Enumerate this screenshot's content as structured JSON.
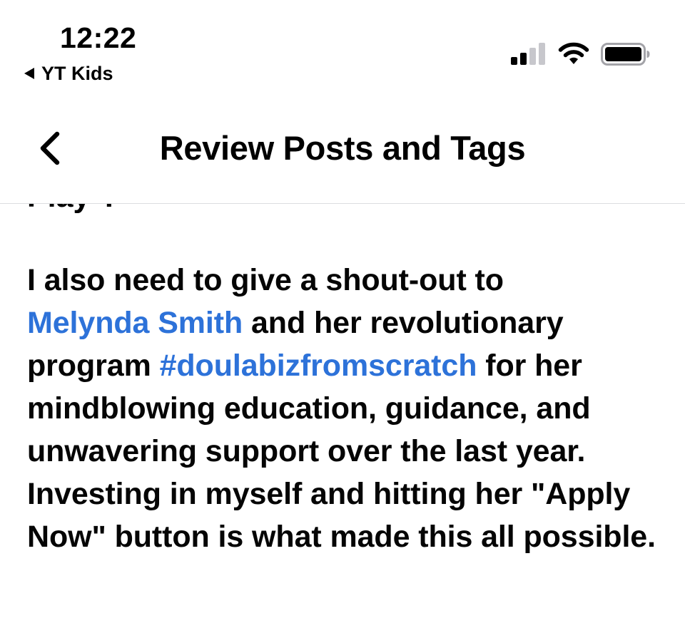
{
  "status_bar": {
    "time": "12:22",
    "back_app_label": "YT Kids",
    "signal_icon": "cellular-signal-icon",
    "wifi_icon": "wifi-icon",
    "battery_icon": "battery-icon"
  },
  "nav": {
    "back_icon": "chevron-left-icon",
    "title": "Review Posts and Tags"
  },
  "post": {
    "clipped_previous_line": "Play\".",
    "lines": [
      [
        "I also need to give a shout-out to"
      ],
      [
        "Melynda Smith",
        " and her revolutionary"
      ],
      [
        "program ",
        "#doulabizfromscratch",
        " for her"
      ],
      [
        "mindblowing education, guidance, and"
      ],
      [
        "unwavering support over the last year."
      ],
      [
        "Investing in myself and hitting her"
      ],
      [
        "\"Apply Now\" button is what made this"
      ],
      [
        "all possible."
      ]
    ],
    "mention": "Melynda Smith",
    "hashtag": "#doulabizfromscratch",
    "text_before_mention": "I also need to give a shout-out to",
    "text_after_mention": " and her revolutionary",
    "text_before_hashtag": "program ",
    "text_after_hashtag": " for her mindblowing education, guidance, and unwavering support over the last year. Investing in myself and hitting her \"Apply Now\" button is what made this all possible.",
    "link_color": "#2d72d9"
  }
}
